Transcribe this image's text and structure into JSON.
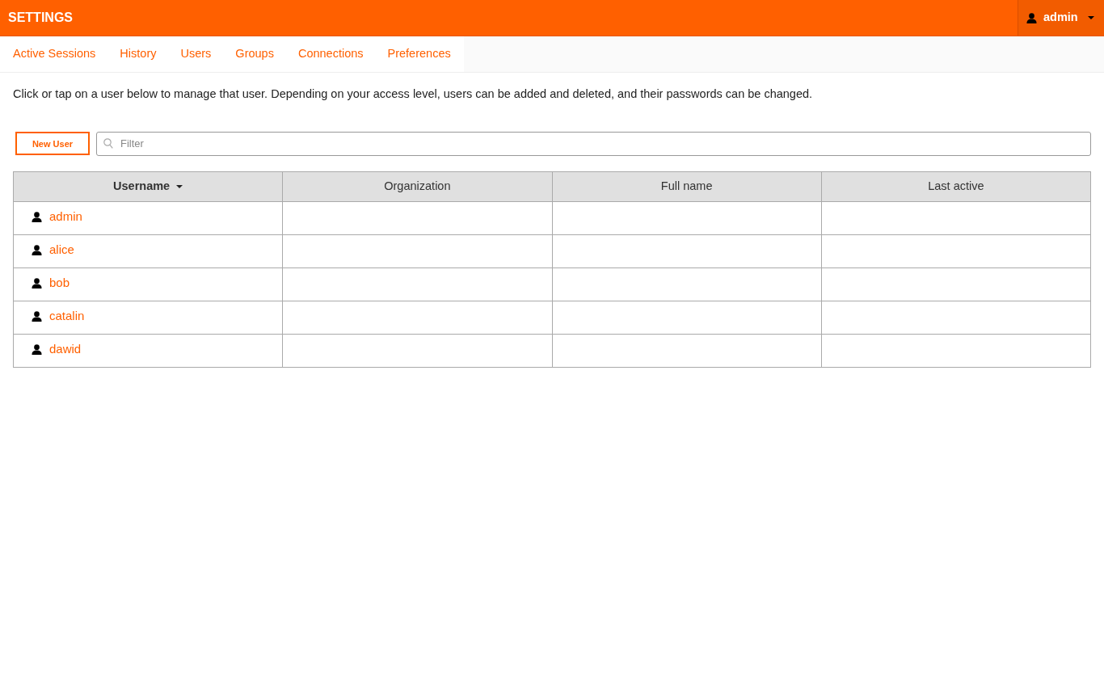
{
  "header": {
    "title": "SETTINGS",
    "user_menu": {
      "label": "admin"
    }
  },
  "tabs": [
    {
      "label": "Active Sessions"
    },
    {
      "label": "History"
    },
    {
      "label": "Users"
    },
    {
      "label": "Groups"
    },
    {
      "label": "Connections"
    },
    {
      "label": "Preferences"
    }
  ],
  "description": "Click or tap on a user below to manage that user. Depending on your access level, users can be added and deleted, and their passwords can be changed.",
  "toolbar": {
    "new_button": "New User",
    "filter": {
      "placeholder": "Filter"
    }
  },
  "table": {
    "columns": [
      {
        "label": "Username",
        "sorted": true
      },
      {
        "label": "Organization",
        "sorted": false
      },
      {
        "label": "Full name",
        "sorted": false
      },
      {
        "label": "Last active",
        "sorted": false
      }
    ],
    "rows": [
      {
        "username": "admin"
      },
      {
        "username": "alice"
      },
      {
        "username": "bob"
      },
      {
        "username": "catalin"
      },
      {
        "username": "dawid"
      }
    ]
  }
}
